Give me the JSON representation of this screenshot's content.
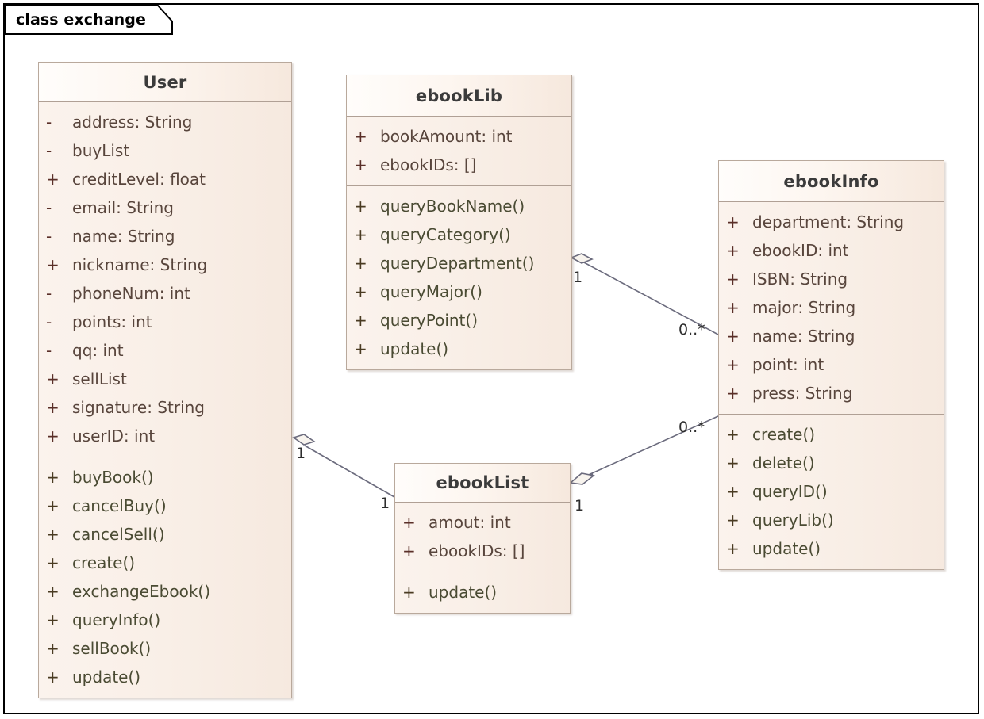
{
  "diagram": {
    "frame_label": "class exchange",
    "accent_border": "#b9a99c",
    "body_fill": "#f8eee6",
    "header_fill": "#fdf6f0",
    "attr_text_color": "#58453c",
    "op_text_color": "#4a4b33",
    "link_color": "#6b6b7d"
  },
  "classes": {
    "user": {
      "name": "User",
      "attributes": [
        {
          "vis": "-",
          "text": "address: String"
        },
        {
          "vis": "-",
          "text": "buyList"
        },
        {
          "vis": "+",
          "text": "creditLevel: float"
        },
        {
          "vis": "-",
          "text": "email: String"
        },
        {
          "vis": "-",
          "text": "name: String"
        },
        {
          "vis": "+",
          "text": "nickname: String"
        },
        {
          "vis": "-",
          "text": "phoneNum: int"
        },
        {
          "vis": "-",
          "text": "points: int"
        },
        {
          "vis": "-",
          "text": "qq: int"
        },
        {
          "vis": "+",
          "text": "sellList"
        },
        {
          "vis": "+",
          "text": "signature: String"
        },
        {
          "vis": "+",
          "text": "userID: int"
        }
      ],
      "operations": [
        {
          "vis": "+",
          "text": "buyBook()"
        },
        {
          "vis": "+",
          "text": "cancelBuy()"
        },
        {
          "vis": "+",
          "text": "cancelSell()"
        },
        {
          "vis": "+",
          "text": "create()"
        },
        {
          "vis": "+",
          "text": "exchangeEbook()"
        },
        {
          "vis": "+",
          "text": "queryInfo()"
        },
        {
          "vis": "+",
          "text": "sellBook()"
        },
        {
          "vis": "+",
          "text": "update()"
        }
      ]
    },
    "ebooklib": {
      "name": "ebookLib",
      "attributes": [
        {
          "vis": "+",
          "text": "bookAmount: int"
        },
        {
          "vis": "+",
          "text": "ebookIDs: []"
        }
      ],
      "operations": [
        {
          "vis": "+",
          "text": "queryBookName()"
        },
        {
          "vis": "+",
          "text": "queryCategory()"
        },
        {
          "vis": "+",
          "text": "queryDepartment()"
        },
        {
          "vis": "+",
          "text": "queryMajor()"
        },
        {
          "vis": "+",
          "text": "queryPoint()"
        },
        {
          "vis": "+",
          "text": "update()"
        }
      ]
    },
    "ebookinfo": {
      "name": "ebookInfo",
      "attributes": [
        {
          "vis": "+",
          "text": "department: String"
        },
        {
          "vis": "+",
          "text": "ebookID: int"
        },
        {
          "vis": "+",
          "text": "ISBN: String"
        },
        {
          "vis": "+",
          "text": "major: String"
        },
        {
          "vis": "+",
          "text": "name: String"
        },
        {
          "vis": "+",
          "text": "point: int"
        },
        {
          "vis": "+",
          "text": "press: String"
        }
      ],
      "operations": [
        {
          "vis": "+",
          "text": "create()"
        },
        {
          "vis": "+",
          "text": "delete()"
        },
        {
          "vis": "+",
          "text": "queryID()"
        },
        {
          "vis": "+",
          "text": "queryLib()"
        },
        {
          "vis": "+",
          "text": "update()"
        }
      ]
    },
    "ebooklist": {
      "name": "ebookList",
      "attributes": [
        {
          "vis": "+",
          "text": "amout: int"
        },
        {
          "vis": "+",
          "text": "ebookIDs: []"
        }
      ],
      "operations": [
        {
          "vis": "+",
          "text": "update()"
        }
      ]
    }
  },
  "associations": [
    {
      "id": "ebooklib-ebookinfo",
      "source": "ebookLib",
      "target": "ebookInfo",
      "source_mult": "1",
      "target_mult": "0..*"
    },
    {
      "id": "user-ebooklist",
      "source": "User",
      "target": "ebookList",
      "source_mult": "1",
      "target_mult": "1"
    },
    {
      "id": "ebooklist-ebookinfo",
      "source": "ebookList",
      "target": "ebookInfo",
      "source_mult": "1",
      "target_mult": "0..*"
    }
  ]
}
